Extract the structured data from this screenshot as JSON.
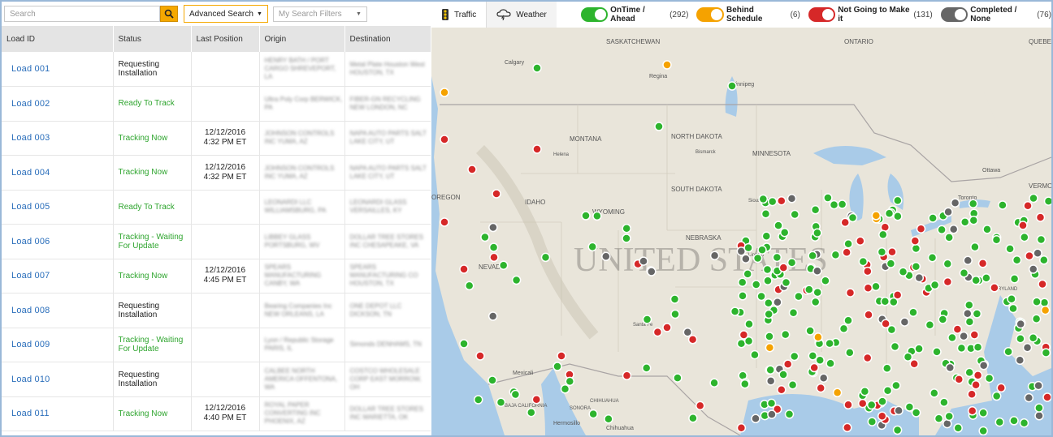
{
  "search": {
    "placeholder": "Search",
    "advanced_label": "Advanced Search",
    "filters_placeholder": "My Search Filters"
  },
  "table": {
    "headers": [
      "Load ID",
      "Status",
      "Last Position",
      "Origin",
      "Destination"
    ],
    "rows": [
      {
        "id": "Load  001",
        "status": "Requesting Installation",
        "status_color": "black",
        "pos1": "",
        "pos2": "",
        "origin": "HENRY BATH / PORT CARGO SHREVEPORT, LA",
        "dest": "Metal Plate Houston West HOUSTON, TX"
      },
      {
        "id": "Load  002",
        "status": "Ready To Track",
        "status_color": "green",
        "pos1": "",
        "pos2": "",
        "origin": "Ultra Poly Corp BERWICK, PA",
        "dest": "FIBER-GN RECYCLING NEW LONDON, NC"
      },
      {
        "id": "Load  003",
        "status": "Tracking Now",
        "status_color": "green",
        "pos1": "12/12/2016",
        "pos2": "4:32 PM ET",
        "origin": "JOHNSON CONTROLS INC YUMA, AZ",
        "dest": "NAPA AUTO PARTS SALT LAKE CITY, UT"
      },
      {
        "id": "Load  004",
        "status": "Tracking Now",
        "status_color": "green",
        "pos1": "12/12/2016",
        "pos2": "4:32 PM ET",
        "origin": "JOHNSON CONTROLS INC YUMA, AZ",
        "dest": "NAPA AUTO PARTS SALT LAKE CITY, UT"
      },
      {
        "id": "Load  005",
        "status": "Ready To Track",
        "status_color": "green",
        "pos1": "",
        "pos2": "",
        "origin": "LEONARDI LLC WILLIAMSBURG, PA",
        "dest": "LEONARDI GLASS VERSAILLES, KY"
      },
      {
        "id": "Load  006",
        "status": "Tracking - Waiting For Update",
        "status_color": "green",
        "pos1": "",
        "pos2": "",
        "origin": "LIBBEY GLASS PORTSBURG, WV",
        "dest": "DOLLAR TREE STORES INC CHESAPEAKE, VA"
      },
      {
        "id": "Load  007",
        "status": "Tracking Now",
        "status_color": "green",
        "pos1": "12/12/2016",
        "pos2": "4:45 PM ET",
        "origin": "SPEARS MANUFACTURING CANBY, WA",
        "dest": "SPEARS MANUFACTURING CO HOUSTON, TX"
      },
      {
        "id": "Load  008",
        "status": "Requesting Installation",
        "status_color": "black",
        "pos1": "",
        "pos2": "",
        "origin": "Bearing Companies Inc NEW ORLEANS, LA",
        "dest": "ONE DEPOT LLC DICKSON, TN"
      },
      {
        "id": "Load  009",
        "status": "Tracking - Waiting For Update",
        "status_color": "green",
        "pos1": "",
        "pos2": "",
        "origin": "Lyon / Republic Storage PARIS, IL",
        "dest": "Simonds DENHAMS, TN"
      },
      {
        "id": "Load  010",
        "status": "Requesting Installation",
        "status_color": "black",
        "pos1": "",
        "pos2": "",
        "origin": "CALBEE NORTH AMERICA OFFENTONA, WA",
        "dest": "COSTCO WHOLESALE CORP EAST MORROW, OH"
      },
      {
        "id": "Load  011",
        "status": "Tracking Now",
        "status_color": "green",
        "pos1": "12/12/2016",
        "pos2": "4:40 PM ET",
        "origin": "ROYAL PAPER CONVERTING INC PHOENIX, AZ",
        "dest": "DOLLAR TREE STORES INC MARIETTA, OK"
      }
    ]
  },
  "map_toolbar": {
    "tabs": [
      {
        "label": "Traffic",
        "icon": "traffic-light-icon"
      },
      {
        "label": "Weather",
        "icon": "cloud-lightning-icon"
      }
    ],
    "legend": [
      {
        "label": "OnTime / Ahead",
        "count": "(292)",
        "color": "#2db42d"
      },
      {
        "label": "Behind Schedule",
        "count": "(6)",
        "color": "#f5a200"
      },
      {
        "label": "Not Going to Make it",
        "count": "(131)",
        "color": "#d62828"
      },
      {
        "label": "Completed / None",
        "count": "(76)",
        "color": "#666666"
      }
    ]
  },
  "map": {
    "big_label": "UNITED STATES",
    "labels": [
      "SASKATCHEWAN",
      "ONTARIO",
      "QUEBEC",
      "Calgary",
      "Regina",
      "Winnipeg",
      "MONTANA",
      "NORTH DAKOTA",
      "Bismarck",
      "MINNESOTA",
      "Helena",
      "Ottawa",
      "OREGON",
      "IDAHO",
      "SOUTH DAKOTA",
      "Sioux Falls",
      "Toronto",
      "VERMO",
      "WYOMING",
      "NEBRASKA",
      "NEVADA",
      "Lincoln",
      "MARYLAND",
      "Santa Fe",
      "Mexicali",
      "BAJA CALIFORNIA",
      "SONORA",
      "CHIHUAHUA",
      "Hermosillo",
      "Chihuahua"
    ]
  }
}
